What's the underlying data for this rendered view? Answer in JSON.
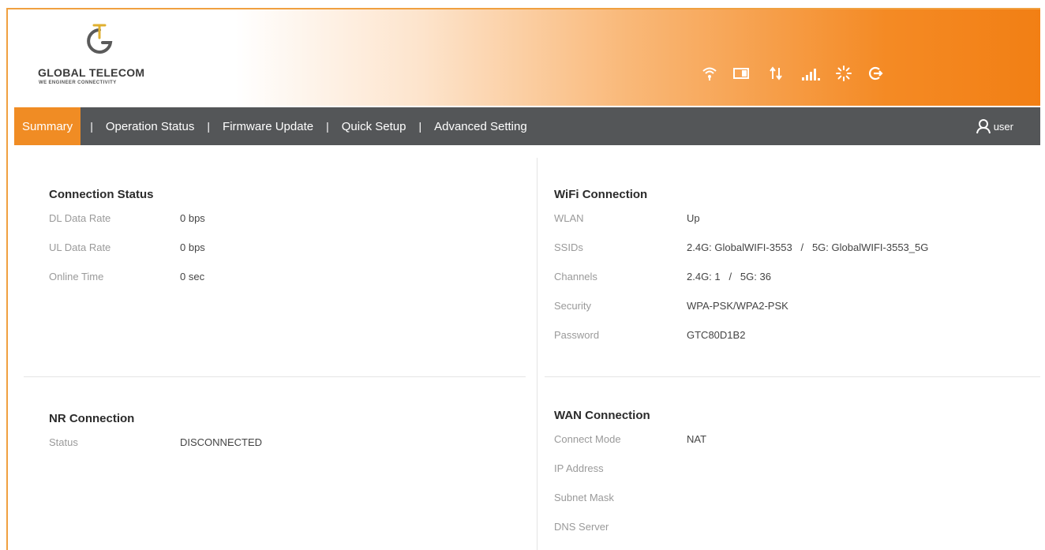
{
  "brand": {
    "name": "GLOBAL TELECOM",
    "tagline": "WE ENGINEER CONNECTIVITY"
  },
  "colors": {
    "accent": "#f08c24",
    "nav_bg": "#545658"
  },
  "status_icons": [
    "wifi-icon",
    "sim-card-icon",
    "data-transfer-icon",
    "signal-bars-icon",
    "loading-icon",
    "logout-icon"
  ],
  "nav": {
    "items": [
      {
        "label": "Summary",
        "active": true
      },
      {
        "label": "Operation Status"
      },
      {
        "label": "Firmware Update"
      },
      {
        "label": "Quick Setup"
      },
      {
        "label": "Advanced Setting"
      }
    ],
    "separator": "|",
    "user_label": "user"
  },
  "connection_status": {
    "title": "Connection Status",
    "rows": [
      {
        "label": "DL Data Rate",
        "value": "0 bps"
      },
      {
        "label": "UL Data Rate",
        "value": "0 bps"
      },
      {
        "label": "Online Time",
        "value": "0 sec"
      }
    ]
  },
  "wifi_connection": {
    "title": "WiFi Connection",
    "rows": [
      {
        "label": "WLAN",
        "value": "Up"
      },
      {
        "label": "SSIDs",
        "value": "2.4G: GlobalWIFI-3553   /   5G: GlobalWIFI-3553_5G"
      },
      {
        "label": "Channels",
        "value": "2.4G: 1   /   5G: 36"
      },
      {
        "label": "Security",
        "value": "WPA-PSK/WPA2-PSK"
      },
      {
        "label": "Password",
        "value": "GTC80D1B2"
      }
    ]
  },
  "nr_connection": {
    "title": "NR Connection",
    "rows": [
      {
        "label": "Status",
        "value": "DISCONNECTED"
      }
    ]
  },
  "wan_connection": {
    "title": "WAN Connection",
    "rows": [
      {
        "label": "Connect Mode",
        "value": "NAT"
      },
      {
        "label": "IP Address",
        "value": ""
      },
      {
        "label": "Subnet Mask",
        "value": ""
      },
      {
        "label": "DNS Server",
        "value": ""
      }
    ]
  }
}
